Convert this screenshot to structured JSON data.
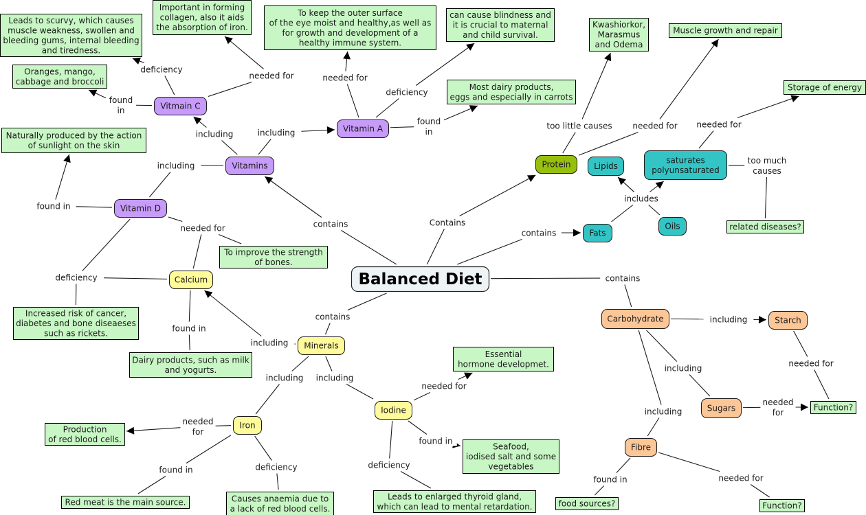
{
  "title": "Balanced Diet",
  "colors": {
    "root": "#eef3f5",
    "vitamin": "#c79bf9",
    "mineral": "#fffa9a",
    "protein": "#97bf0d",
    "fat": "#33c5c5",
    "carb": "#fdc697",
    "leaf": "#c8f7c5"
  },
  "concepts": [
    {
      "id": "balanced-diet",
      "label": "Balanced Diet",
      "kind": "root"
    },
    {
      "id": "vitamins",
      "label": "Vitamins",
      "kind": "vitamin"
    },
    {
      "id": "vitamin-c",
      "label": "Vitmain C",
      "kind": "vitamin"
    },
    {
      "id": "vitamin-a",
      "label": "Vitamin A",
      "kind": "vitamin"
    },
    {
      "id": "vitamin-d",
      "label": "Vitamin D",
      "kind": "vitamin"
    },
    {
      "id": "calcium",
      "label": "Calcium",
      "kind": "mineral"
    },
    {
      "id": "minerals",
      "label": "Minerals",
      "kind": "mineral"
    },
    {
      "id": "iron",
      "label": "Iron",
      "kind": "mineral"
    },
    {
      "id": "iodine",
      "label": "Iodine",
      "kind": "mineral"
    },
    {
      "id": "protein",
      "label": "Protein",
      "kind": "protein"
    },
    {
      "id": "lipids",
      "label": "Lipids",
      "kind": "fat"
    },
    {
      "id": "fats",
      "label": "Fats",
      "kind": "fat"
    },
    {
      "id": "oils",
      "label": "Oils",
      "kind": "fat"
    },
    {
      "id": "saturates",
      "label": "saturates\npolyunsaturated",
      "kind": "fat"
    },
    {
      "id": "carbohydrate",
      "label": "Carbohydrate",
      "kind": "carb"
    },
    {
      "id": "starch",
      "label": "Starch",
      "kind": "carb"
    },
    {
      "id": "sugars",
      "label": "Sugars",
      "kind": "carb"
    },
    {
      "id": "fibre",
      "label": "Fibre",
      "kind": "carb"
    },
    {
      "id": "scurvy",
      "label": "Leads to scurvy, which causes\nmuscle weakness, swollen and\nbleeding gums, internal bleeding\nand tiredness.",
      "kind": "leaf"
    },
    {
      "id": "collagen",
      "label": "Important in forming\ncollagen, also it aids\nthe absorption of iron.",
      "kind": "leaf"
    },
    {
      "id": "oranges",
      "label": "Oranges, mango,\ncabbage and broccoli",
      "kind": "leaf"
    },
    {
      "id": "eye",
      "label": "To keep the outer surface\nof the eye moist and healthy,as well as\nfor growth and development of a\nhealthy immune system.",
      "kind": "leaf"
    },
    {
      "id": "blindness",
      "label": "can cause blindness and\nit is crucial to maternal\nand child survival.",
      "kind": "leaf"
    },
    {
      "id": "dairy-carrots",
      "label": "Most dairy products,\neggs and especially in carrots",
      "kind": "leaf"
    },
    {
      "id": "sunlight",
      "label": "Naturally produced by the action\nof sunlight on the skin",
      "kind": "leaf"
    },
    {
      "id": "bones",
      "label": "To improve the strength\nof bones.",
      "kind": "leaf"
    },
    {
      "id": "cancer",
      "label": "Increased risk of cancer,\ndiabetes and bone diseaeses\nsuch as rickets.",
      "kind": "leaf"
    },
    {
      "id": "milk",
      "label": "Dairy products, such as milk\nand yogurts.",
      "kind": "leaf"
    },
    {
      "id": "rbc",
      "label": "Production\nof red blood cells.",
      "kind": "leaf"
    },
    {
      "id": "red-meat",
      "label": "Red meat is the main source.",
      "kind": "leaf"
    },
    {
      "id": "anaemia",
      "label": "Causes anaemia due to\na lack of red blood cells.",
      "kind": "leaf"
    },
    {
      "id": "hormone",
      "label": "Essential\nhormone developmet.",
      "kind": "leaf"
    },
    {
      "id": "seafood",
      "label": "Seafood,\niodised salt and some\nvegetables",
      "kind": "leaf"
    },
    {
      "id": "thyroid",
      "label": "Leads to enlarged thyroid gland,\nwhich can lead to mental retardation.",
      "kind": "leaf"
    },
    {
      "id": "kwashiorkor",
      "label": "Kwashiorkor,\nMarasmus\nand Odema",
      "kind": "leaf"
    },
    {
      "id": "muscle",
      "label": "Muscle growth and repair",
      "kind": "leaf"
    },
    {
      "id": "energy",
      "label": "Storage of energy",
      "kind": "leaf"
    },
    {
      "id": "diseases",
      "label": "related diseases?",
      "kind": "leaf"
    },
    {
      "id": "function-starch",
      "label": "Function?",
      "kind": "leaf"
    },
    {
      "id": "function-fibre",
      "label": "Function?",
      "kind": "leaf"
    },
    {
      "id": "food-sources",
      "label": "food sources?",
      "kind": "leaf"
    }
  ],
  "links": [
    {
      "id": "l-bd-vitamins",
      "label": "contains"
    },
    {
      "id": "l-bd-protein",
      "label": "Contains"
    },
    {
      "id": "l-bd-fats",
      "label": "contains"
    },
    {
      "id": "l-bd-carb",
      "label": "contains"
    },
    {
      "id": "l-bd-minerals",
      "label": "contains"
    },
    {
      "id": "l-vit-c",
      "label": "including"
    },
    {
      "id": "l-vit-a",
      "label": "including"
    },
    {
      "id": "l-vit-d",
      "label": "including"
    },
    {
      "id": "l-c-deficiency",
      "label": "deficiency"
    },
    {
      "id": "l-c-needed",
      "label": "needed for"
    },
    {
      "id": "l-c-found",
      "label": "found\nin"
    },
    {
      "id": "l-a-needed",
      "label": "needed for"
    },
    {
      "id": "l-a-deficiency",
      "label": "deficiency"
    },
    {
      "id": "l-a-found",
      "label": "found\nin"
    },
    {
      "id": "l-d-found",
      "label": "found in"
    },
    {
      "id": "l-d-needed",
      "label": "needed for"
    },
    {
      "id": "l-d-deficiency",
      "label": "deficiency"
    },
    {
      "id": "l-ca-found",
      "label": "found in"
    },
    {
      "id": "l-min-calcium",
      "label": "including"
    },
    {
      "id": "l-min-iron",
      "label": "including"
    },
    {
      "id": "l-min-iodine",
      "label": "including"
    },
    {
      "id": "l-iron-needed",
      "label": "needed\nfor"
    },
    {
      "id": "l-iron-found",
      "label": "found in"
    },
    {
      "id": "l-iron-deficiency",
      "label": "deficiency"
    },
    {
      "id": "l-iod-needed",
      "label": "needed for"
    },
    {
      "id": "l-iod-found",
      "label": "found in"
    },
    {
      "id": "l-iod-deficiency",
      "label": "deficiency"
    },
    {
      "id": "l-pro-little",
      "label": "too little causes"
    },
    {
      "id": "l-pro-needed",
      "label": "needed for"
    },
    {
      "id": "l-fats-includes",
      "label": "includes"
    },
    {
      "id": "l-sat-needed",
      "label": "needed for"
    },
    {
      "id": "l-sat-toomuch",
      "label": "too much\ncauses"
    },
    {
      "id": "l-carb-starch",
      "label": "including"
    },
    {
      "id": "l-carb-sugars",
      "label": "including"
    },
    {
      "id": "l-carb-fibre",
      "label": "including"
    },
    {
      "id": "l-starch-needed",
      "label": "needed for"
    },
    {
      "id": "l-sugars-needed",
      "label": "needed\nfor"
    },
    {
      "id": "l-fibre-found",
      "label": "found in"
    },
    {
      "id": "l-fibre-needed",
      "label": "needed for"
    }
  ]
}
